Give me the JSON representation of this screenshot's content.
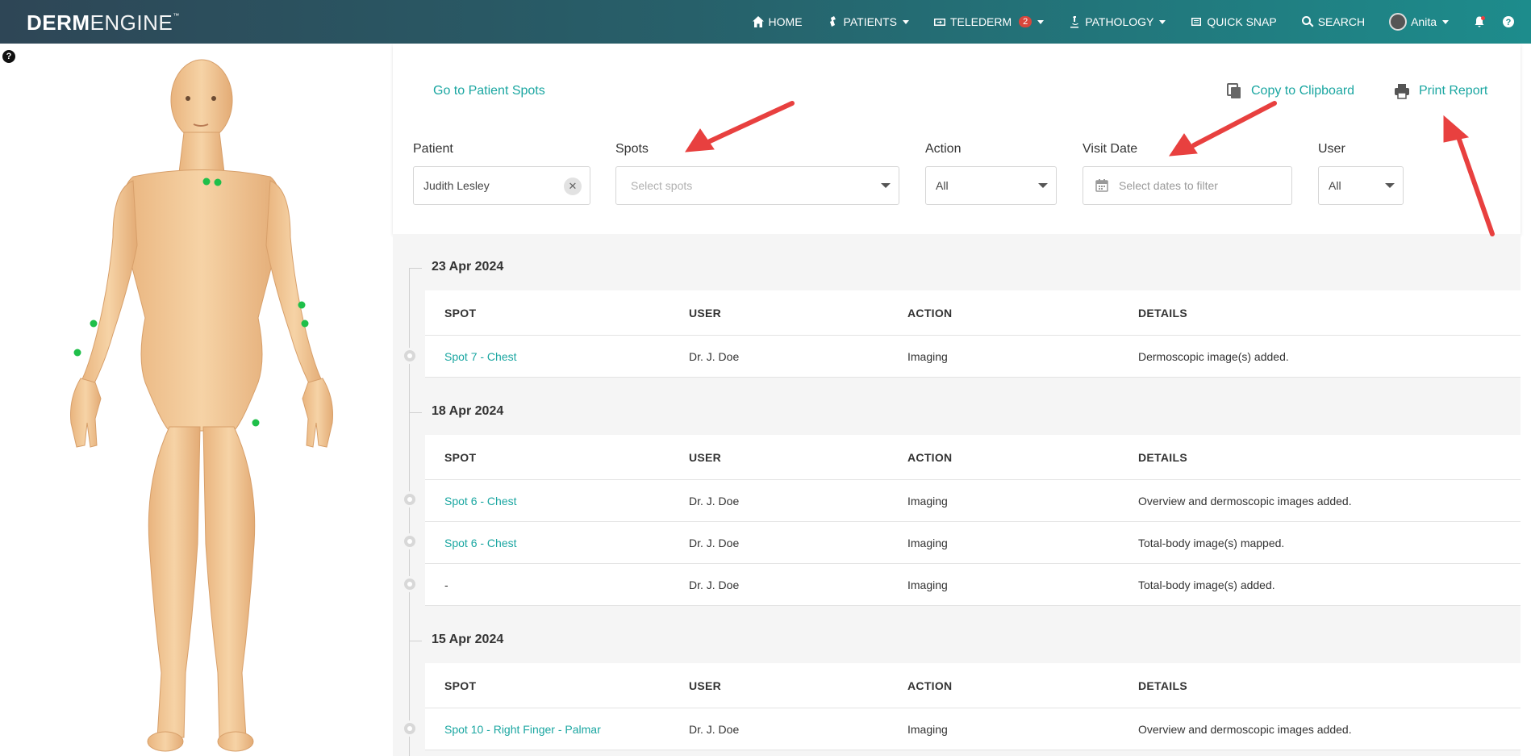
{
  "brand": {
    "bold": "DERM",
    "light": "ENGINE",
    "tm": "™"
  },
  "nav": {
    "home": "HOME",
    "patients": "PATIENTS",
    "telederm": "TELEDERM",
    "telederm_badge": "2",
    "pathology": "PATHOLOGY",
    "quick_snap": "QUICK SNAP",
    "search": "SEARCH",
    "user": "Anita"
  },
  "help": "?",
  "links": {
    "go_to_spots": "Go to Patient Spots",
    "copy": "Copy to Clipboard",
    "print": "Print Report"
  },
  "filters": {
    "patient_label": "Patient",
    "patient_value": "Judith Lesley",
    "spots_label": "Spots",
    "spots_placeholder": "Select spots",
    "action_label": "Action",
    "action_value": "All",
    "visit_label": "Visit Date",
    "visit_placeholder": "Select dates to filter",
    "user_label": "User",
    "user_value": "All"
  },
  "table_headers": {
    "spot": "SPOT",
    "user": "USER",
    "action": "ACTION",
    "details": "DETAILS"
  },
  "groups": [
    {
      "date": "23 Apr 2024",
      "rows": [
        {
          "spot": "Spot 7 - Chest",
          "user": "Dr. J. Doe",
          "action": "Imaging",
          "details": "Dermoscopic image(s) added."
        }
      ]
    },
    {
      "date": "18 Apr 2024",
      "rows": [
        {
          "spot": "Spot 6 - Chest",
          "user": "Dr. J. Doe",
          "action": "Imaging",
          "details": "Overview and dermoscopic images added."
        },
        {
          "spot": "Spot 6 - Chest",
          "user": "Dr. J. Doe",
          "action": "Imaging",
          "details": "Total-body image(s) mapped."
        },
        {
          "spot": "-",
          "user": "Dr. J. Doe",
          "action": "Imaging",
          "details": "Total-body image(s) added."
        }
      ]
    },
    {
      "date": "15 Apr 2024",
      "rows": [
        {
          "spot": "Spot 10 - Right Finger - Palmar",
          "user": "Dr. J. Doe",
          "action": "Imaging",
          "details": "Overview and dermoscopic images added."
        }
      ]
    }
  ],
  "colors": {
    "accent": "#1aa6a1",
    "arrow": "#e8403f",
    "spot_marker": "#1fbf4a",
    "skin": "#f2c896"
  }
}
